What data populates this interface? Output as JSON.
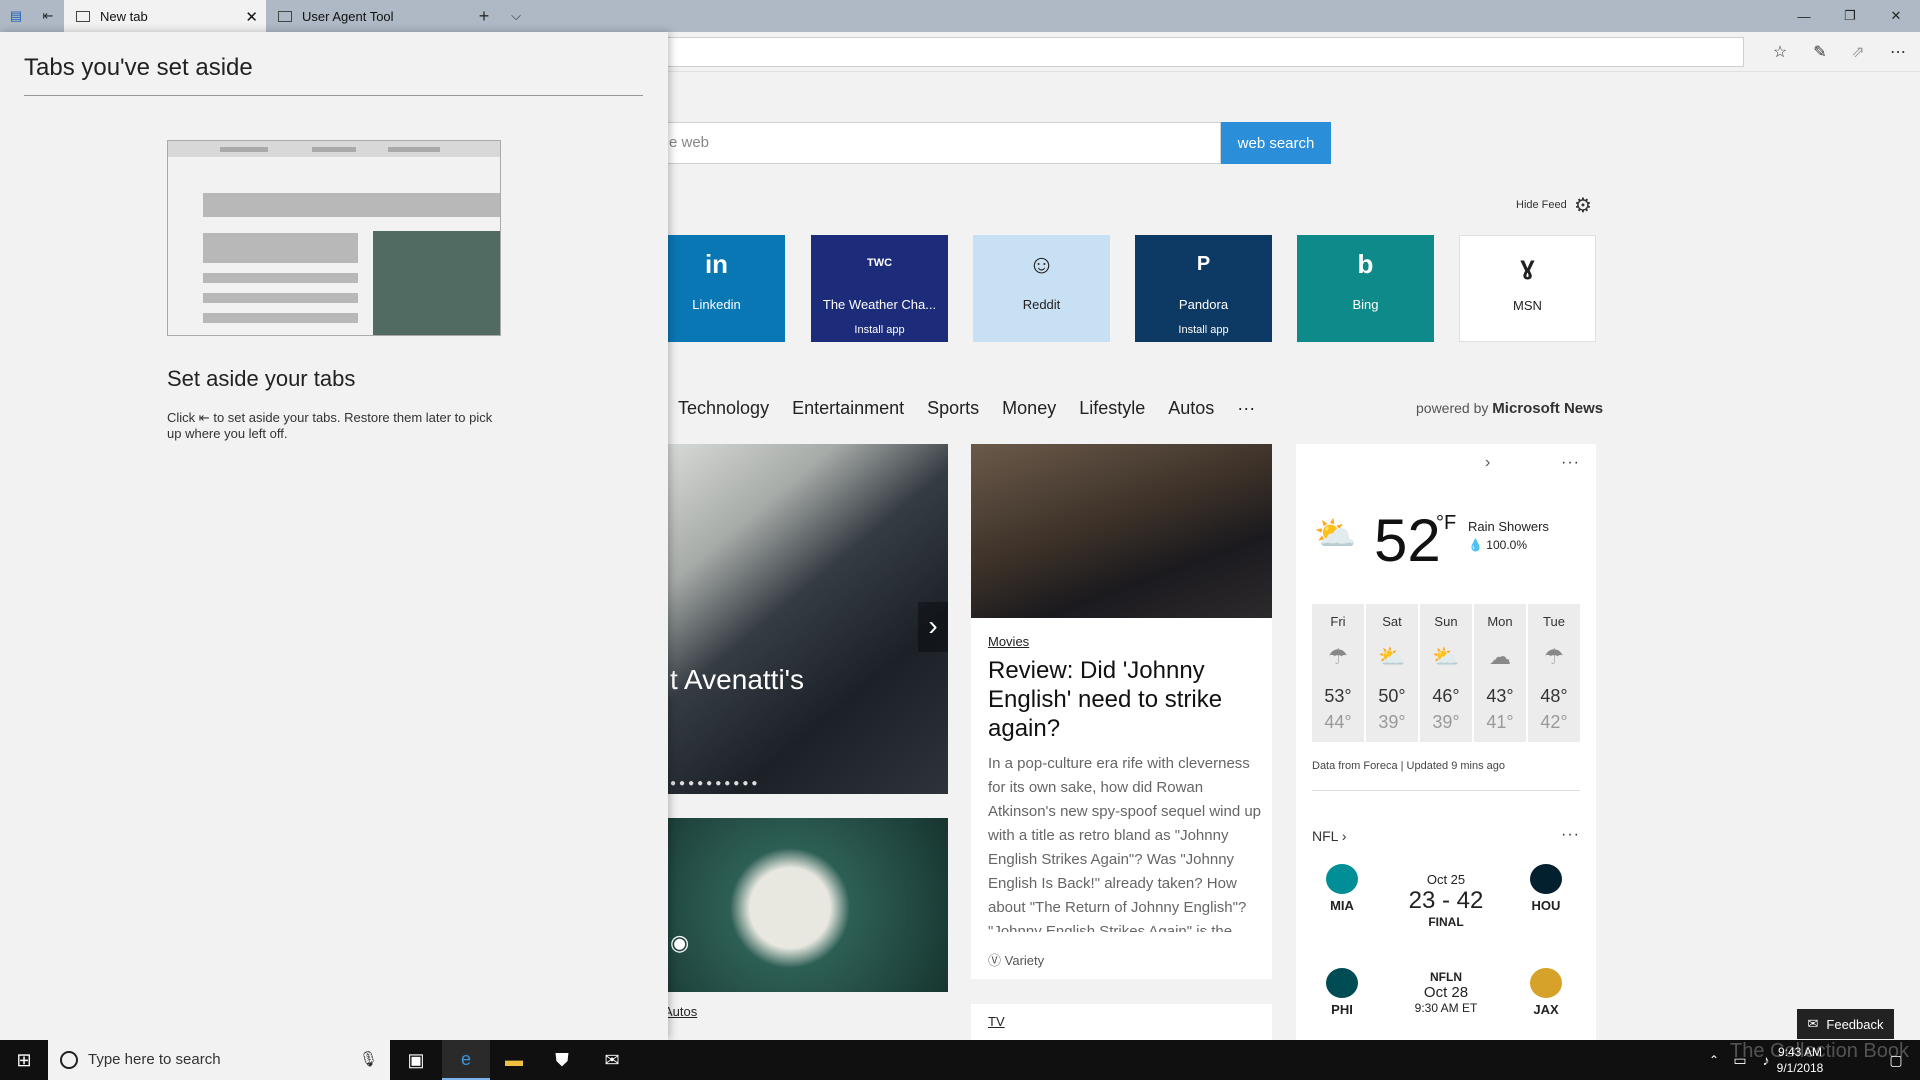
{
  "browser": {
    "tabs": [
      {
        "label": "New tab"
      },
      {
        "label": "User Agent Tool"
      }
    ],
    "new_tab_glyph": "+",
    "tab_list_glyph": "⌵",
    "window_controls": {
      "minimize": "—",
      "maximize": "❐",
      "close": "✕"
    }
  },
  "set_aside": {
    "heading": "Tabs you've set aside",
    "title": "Set aside your tabs",
    "desc_before": "Click",
    "desc_after": "to set aside your tabs. Restore them later to pick up where you left off."
  },
  "search": {
    "placeholder": "e web",
    "button": "web search"
  },
  "feed_controls": {
    "hide_feed": "Hide Feed"
  },
  "tiles": [
    {
      "glyph": "in",
      "name": "Linkedin",
      "install": "",
      "color": "#0a77b5"
    },
    {
      "glyph": "TWC",
      "name": "The Weather Cha...",
      "install": "Install app",
      "color": "#1c2c7a"
    },
    {
      "glyph": "☺",
      "name": "Reddit",
      "install": "",
      "color": "#c8e0f4"
    },
    {
      "glyph": "P",
      "name": "Pandora",
      "install": "Install app",
      "color": "#0d3a64"
    },
    {
      "glyph": "b",
      "name": "Bing",
      "install": "",
      "color": "#0f8a8a"
    },
    {
      "glyph": "ɣ",
      "name": "MSN",
      "install": "",
      "color": "#ffffff"
    }
  ],
  "categories": [
    "Technology",
    "Entertainment",
    "Sports",
    "Money",
    "Lifestyle",
    "Autos",
    "···"
  ],
  "powered_by": {
    "prefix": "powered by",
    "brand": "Microsoft News"
  },
  "hero": {
    "caption": "t Avenatti's"
  },
  "article": {
    "category": "Movies",
    "title": "Review: Did 'Johnny English' need to strike again?",
    "body": "In a pop-culture era rife with cleverness for its own sake, how did Rowan Atkinson's new spy-spoof sequel wind up with a title as retro bland as \"Johnny English Strikes Again\"? Was \"Johnny English Is Back!\" already taken? How about \"The Return of Johnny English\"? \"Johnny English Strikes Again\" is the",
    "source": "Variety"
  },
  "autos_label": "Autos",
  "tv_label": "TV",
  "weather": {
    "temp": "52",
    "unit": "°F",
    "condition": "Rain Showers",
    "precip": "100.0%",
    "forecast": [
      {
        "day": "Fri",
        "hi": "53°",
        "lo": "44°",
        "icon": "☂"
      },
      {
        "day": "Sat",
        "hi": "50°",
        "lo": "39°",
        "icon": "⛅"
      },
      {
        "day": "Sun",
        "hi": "46°",
        "lo": "39°",
        "icon": "⛅"
      },
      {
        "day": "Mon",
        "hi": "43°",
        "lo": "41°",
        "icon": "☁"
      },
      {
        "day": "Tue",
        "hi": "48°",
        "lo": "42°",
        "icon": "☂"
      }
    ],
    "source": "Data from Foreca | Updated 9 mins ago"
  },
  "nfl": {
    "label": "NFL",
    "games": [
      {
        "away": "MIA",
        "home": "HOU",
        "date": "Oct 25",
        "score": "23 - 42",
        "status": "FINAL",
        "away_color": "#008e97",
        "home_color": "#03202f"
      },
      {
        "away": "PHI",
        "home": "JAX",
        "date": "Oct 28",
        "score": "NFLN",
        "status": "9:30 AM ET",
        "away_color": "#004c54",
        "home_color": "#d7a22a"
      }
    ]
  },
  "feedback": "Feedback",
  "taskbar": {
    "search_placeholder": "Type here to search",
    "time": "9:43 AM",
    "date": "9/1/2018"
  },
  "watermark": "The Collection Book"
}
